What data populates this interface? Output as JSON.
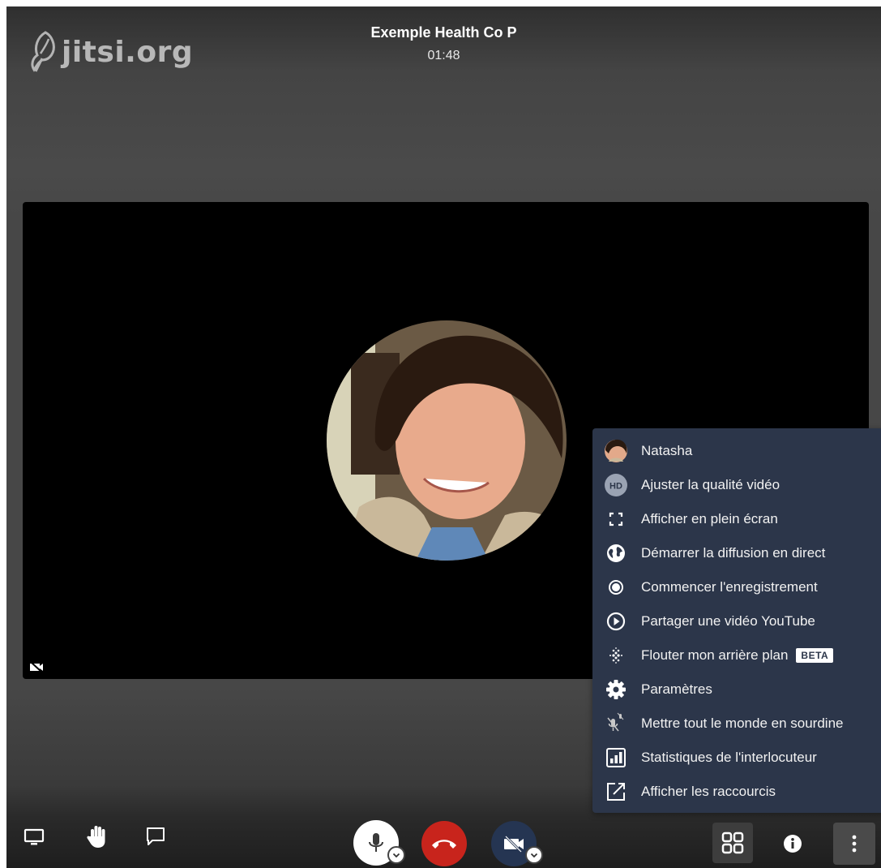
{
  "header": {
    "title": "Exemple Health Co P",
    "timer": "01:48"
  },
  "logo": {
    "text": "jitsi.org"
  },
  "overflow_menu": {
    "items": [
      {
        "label": "Natasha",
        "icon": "user-avatar-icon"
      },
      {
        "label": "Ajuster la qualité vidéo",
        "icon": "hd-icon",
        "icon_text": "HD"
      },
      {
        "label": "Afficher en plein écran",
        "icon": "fullscreen-icon"
      },
      {
        "label": "Démarrer la diffusion en direct",
        "icon": "globe-icon"
      },
      {
        "label": "Commencer l'enregistrement",
        "icon": "record-icon"
      },
      {
        "label": "Partager une vidéo YouTube",
        "icon": "play-circle-icon"
      },
      {
        "label": "Flouter mon arrière plan",
        "icon": "blur-icon",
        "badge": "BETA"
      },
      {
        "label": "Paramètres",
        "icon": "gear-icon"
      },
      {
        "label": "Mettre tout le monde en sourdine",
        "icon": "mute-everyone-icon"
      },
      {
        "label": "Statistiques de l'interlocuteur",
        "icon": "stats-icon"
      },
      {
        "label": "Afficher les raccourcis",
        "icon": "shortcuts-icon"
      }
    ]
  },
  "colors": {
    "menu_bg": "#2c364a",
    "hangup": "#c8241c",
    "video_btn": "#253552",
    "mic_btn": "#ffffff"
  }
}
